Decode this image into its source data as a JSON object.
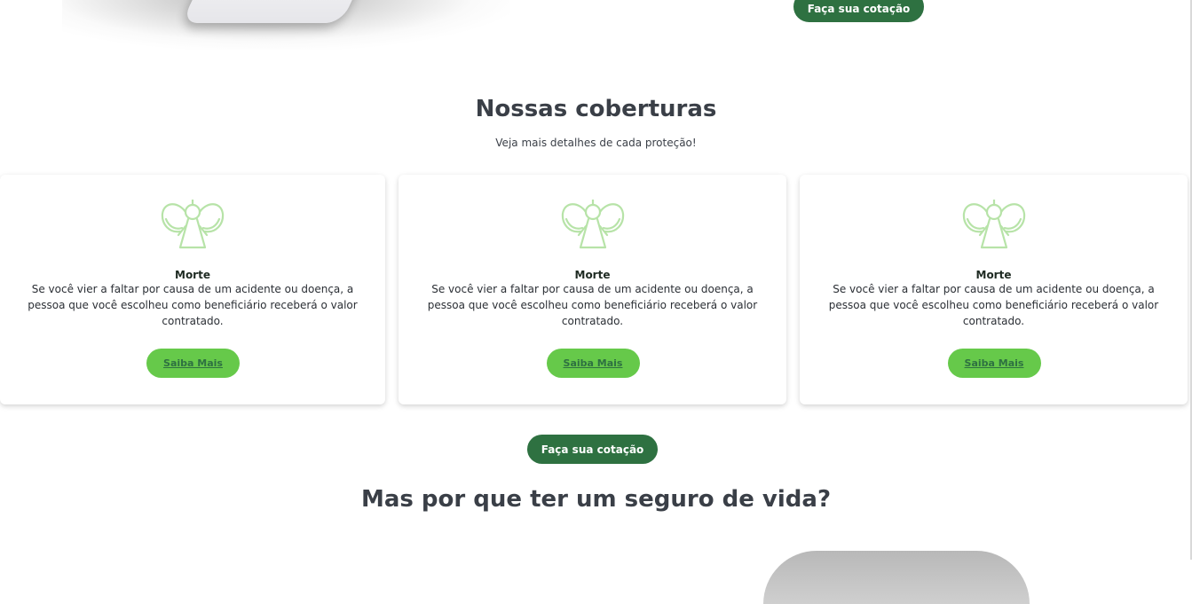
{
  "header": {
    "quote_button_label": "Faça sua cotação"
  },
  "coverages": {
    "title": "Nossas coberturas",
    "subtitle": "Veja mais detalhes de cada proteção!",
    "icon": "angel-icon",
    "accent_color": "#66c94a",
    "cards": [
      {
        "title": "Morte",
        "text": "Se você vier a faltar por causa de um acidente ou doença, a pessoa que você escolheu como beneficiário receberá o valor contratado.",
        "button_label": "Saiba Mais"
      },
      {
        "title": "Morte",
        "text": "Se você vier a faltar por causa de um acidente ou doença, a pessoa que você escolheu como beneficiário receberá o valor contratado.",
        "button_label": "Saiba Mais"
      },
      {
        "title": "Morte",
        "text": "Se você vier a faltar por causa de um acidente ou doença, a pessoa que você escolheu como beneficiário receberá o valor contratado.",
        "button_label": "Saiba Mais"
      }
    ],
    "quote_button_label": "Faça sua cotação"
  },
  "why": {
    "title": "Mas por que ter um seguro de vida?"
  },
  "colors": {
    "primary_dark": "#2e7141",
    "primary_light": "#66c94a",
    "heading": "#3a3f47"
  }
}
